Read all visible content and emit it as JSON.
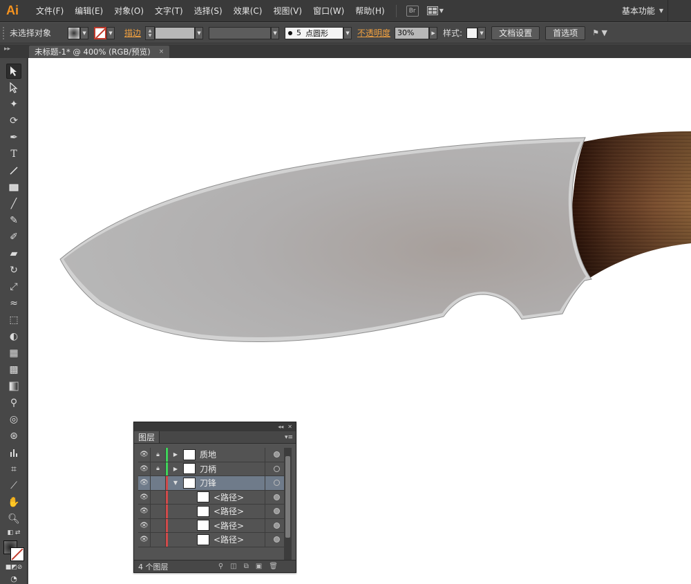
{
  "app": {
    "logo": "Ai"
  },
  "menu": [
    "文件(F)",
    "编辑(E)",
    "对象(O)",
    "文字(T)",
    "选择(S)",
    "效果(C)",
    "视图(V)",
    "窗口(W)",
    "帮助(H)"
  ],
  "bridge_label": "Br",
  "workspace": {
    "label": "基本功能"
  },
  "control": {
    "selection_label": "未选择对象",
    "stroke_label": "描边",
    "brush_size": "5",
    "brush_name": "点圆形",
    "opacity_label": "不透明度",
    "opacity_value": "30%",
    "style_label": "样式:",
    "doc_setup_button": "文档设置",
    "preferences_button": "首选项"
  },
  "document_tab": {
    "title": "未标题-1* @ 400% (RGB/预览)",
    "close": "×"
  },
  "colors": {
    "accent": "#f7931e",
    "stroke_label": "#f0a040",
    "layer_green": "#3fd35a",
    "layer_red": "#d04a4a",
    "layer_blue": "#4a6ad0",
    "handle_dark": "#3f2416",
    "blade": "#b3b3b3"
  },
  "layers_panel": {
    "tab": "图层",
    "rows": [
      {
        "name": "质地",
        "locked": true,
        "color": "#3fd35a",
        "expander": "▶",
        "indent": 0,
        "selected": false
      },
      {
        "name": "刀柄",
        "locked": true,
        "color": "#3fd35a",
        "expander": "▶",
        "indent": 0,
        "selected": false
      },
      {
        "name": "刀锋",
        "locked": false,
        "color": "#d04a4a",
        "expander": "▼",
        "indent": 0,
        "selected": true
      },
      {
        "name": "<路径>",
        "locked": false,
        "color": "#d04a4a",
        "expander": "",
        "indent": 1,
        "selected": false
      },
      {
        "name": "<路径>",
        "locked": false,
        "color": "#d04a4a",
        "expander": "",
        "indent": 1,
        "selected": false
      },
      {
        "name": "<路径>",
        "locked": false,
        "color": "#d04a4a",
        "expander": "",
        "indent": 1,
        "selected": false
      },
      {
        "name": "<路径>",
        "locked": false,
        "color": "#d04a4a",
        "expander": "",
        "indent": 1,
        "selected": false
      }
    ],
    "footer": "4 个图层"
  },
  "toolbar": {
    "tools": [
      "selection-tool",
      "direct-selection-tool",
      "magic-wand-tool",
      "lasso-tool",
      "pen-tool",
      "type-tool",
      "line-tool",
      "rectangle-tool",
      "paintbrush-tool",
      "pencil-tool",
      "blob-brush-tool",
      "eraser-tool",
      "rotate-tool",
      "scale-tool",
      "width-tool",
      "free-transform-tool",
      "shape-builder-tool",
      "perspective-grid-tool",
      "mesh-tool",
      "gradient-tool",
      "eyedropper-tool",
      "blend-tool",
      "symbol-sprayer-tool",
      "column-graph-tool",
      "artboard-tool",
      "slice-tool",
      "hand-tool",
      "zoom-tool"
    ]
  }
}
